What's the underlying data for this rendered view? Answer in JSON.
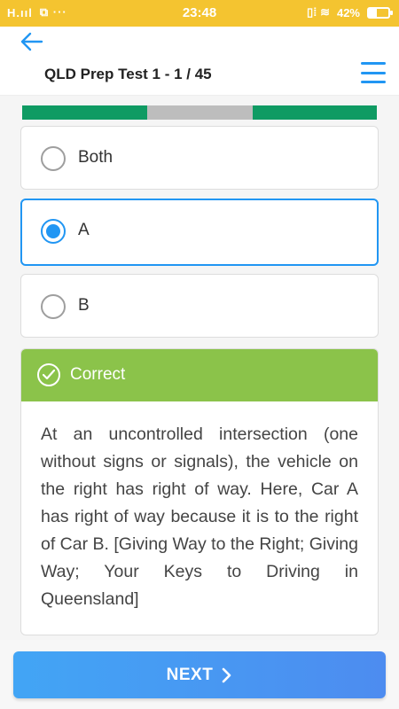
{
  "status_bar": {
    "signal": "H.ııl",
    "extras": "⧉ ···",
    "time": "23:48",
    "icons": "▯⁞ ≋",
    "battery": "42%",
    "battery_level": 0.42
  },
  "header": {
    "title": "QLD Prep Test 1 - 1 / 45",
    "back_icon": "arrow-left-icon",
    "menu_icon": "hamburger-menu-icon"
  },
  "progress": {
    "segments": [
      {
        "status": "correct",
        "color": "#0f9b63"
      },
      {
        "status": "neutral",
        "color": "#bdbdbd"
      },
      {
        "status": "correct",
        "color": "#0f9b63"
      }
    ]
  },
  "options": [
    {
      "label": "Both",
      "selected": false
    },
    {
      "label": "A",
      "selected": true
    },
    {
      "label": "B",
      "selected": false
    }
  ],
  "result": {
    "status": "Correct",
    "color": "#8bc34a",
    "explanation": "At an uncontrolled intersection (one without signs or signals), the vehicle on the right has right of way. Here, Car A has right of way because it is to the right of Car B. [Giving Way to the Right; Giving Way; Your Keys to Driving in Queensland]"
  },
  "next_button": {
    "label": "NEXT",
    "icon": "chevron-right-icon"
  },
  "colors": {
    "accent": "#2196f3",
    "status_bar": "#f4c430"
  }
}
